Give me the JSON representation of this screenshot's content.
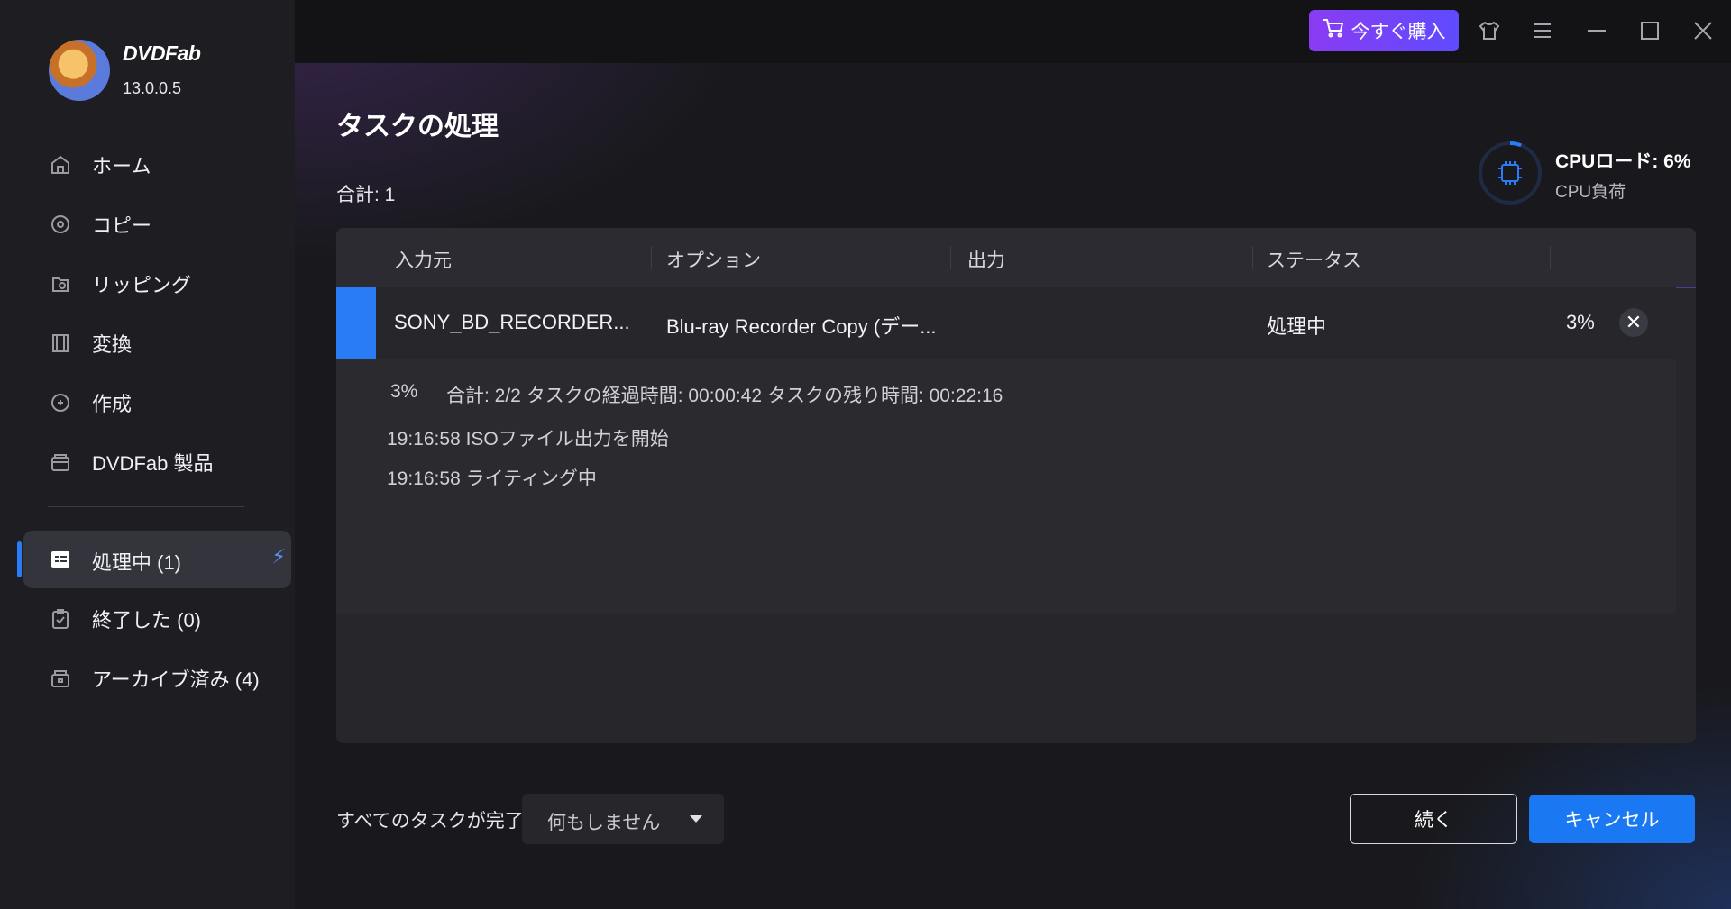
{
  "app": {
    "brand": "DVDFab",
    "version": "13.0.0.5"
  },
  "sidebar": {
    "items": [
      {
        "label": "ホーム",
        "icon": "home-icon"
      },
      {
        "label": "コピー",
        "icon": "copy-disc-icon"
      },
      {
        "label": "リッピング",
        "icon": "ripping-icon"
      },
      {
        "label": "変換",
        "icon": "film-icon"
      },
      {
        "label": "作成",
        "icon": "create-disc-icon"
      },
      {
        "label": "DVDFab 製品",
        "icon": "products-icon"
      }
    ],
    "queue": [
      {
        "label": "処理中 (1)",
        "icon": "task-list-icon",
        "active": true
      },
      {
        "label": "終了した (0)",
        "icon": "clipboard-check-icon"
      },
      {
        "label": "アーカイブ済み (4)",
        "icon": "archive-icon"
      }
    ]
  },
  "titlebar": {
    "buy_label": "今すぐ購入"
  },
  "main": {
    "title": "タスクの処理",
    "total": "合計: 1",
    "cpu": {
      "title": "CPUロード: 6%",
      "subtitle": "CPU負荷",
      "load": 0.06
    },
    "table": {
      "headers": [
        "入力元",
        "オプション",
        "出力",
        "ステータス"
      ],
      "row": {
        "input": "SONY_BD_RECORDER...",
        "option": "Blu-ray Recorder Copy (デー...",
        "output": "",
        "status": "処理中",
        "percent": "3%"
      },
      "detail": {
        "percent": "3%",
        "summary": "合計: 2/2  タスクの経過時間: 00:00:42  タスクの残り時間: 00:22:16",
        "logs": [
          "19:16:58  ISOファイル出力を開始",
          "19:16:58  ライティング中"
        ]
      }
    },
    "footer": {
      "label": "すべてのタスクが完了:",
      "select_value": "何もしません",
      "continue_label": "続く",
      "cancel_label": "キャンセル"
    }
  },
  "colors": {
    "accent": "#1a78f2",
    "buy_gradient_start": "#8a3cf2",
    "buy_gradient_end": "#5f4bff"
  }
}
